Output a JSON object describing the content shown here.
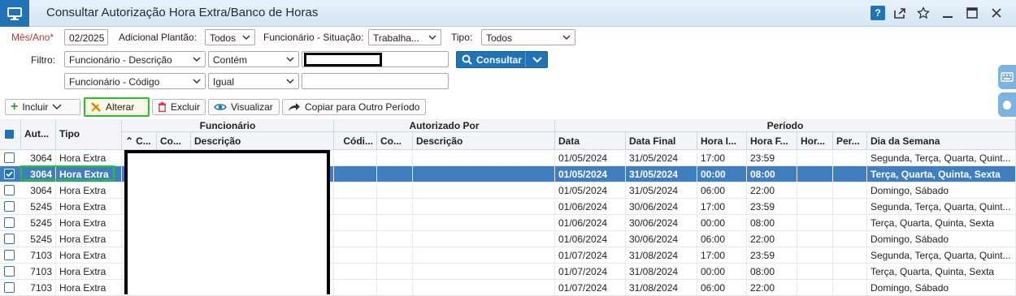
{
  "window": {
    "title": "Consultar Autorização Hora Extra/Banco de Horas",
    "help_label": "?"
  },
  "filters": {
    "mes_ano_label": "Mês/Ano*",
    "mes_ano_value": "02/2025",
    "adicional_label": "Adicional Plantão:",
    "adicional_value": "Todos",
    "func_situacao_label": "Funcionário - Situação:",
    "func_situacao_value": "Trabalha...",
    "tipo_label": "Tipo:",
    "tipo_value": "Todos",
    "filtro_label": "Filtro:",
    "filtro1_field": "Funcionário - Descrição",
    "filtro1_operator": "Contém",
    "filtro1_value": "",
    "filtro2_field": "Funcionário - Código",
    "filtro2_operator": "Igual",
    "filtro2_value": "",
    "consultar_label": "Consultar"
  },
  "toolbar": {
    "incluir": "Incluir",
    "alterar": "Alterar",
    "excluir": "Excluir",
    "visualizar": "Visualizar",
    "copiar": "Copiar para Outro Período"
  },
  "grid": {
    "group_headers": {
      "funcionario": "Funcionário",
      "autorizado_por": "Autorizado Por",
      "periodo": "Período"
    },
    "columns": {
      "aut": "Aut...",
      "tipo": "Tipo",
      "func_c": "C...",
      "func_co": "Co...",
      "func_desc": "Descrição",
      "aut_codi": "Códi...",
      "aut_co": "Co...",
      "aut_desc": "Descrição",
      "data": "Data",
      "data_final": "Data Final",
      "hora_i": "Hora I...",
      "hora_f": "Hora F...",
      "hor": "Hor...",
      "per": "Per...",
      "dia_semana": "Dia da Semana"
    },
    "rows": [
      {
        "aut": "3064",
        "tipo": "Hora Extra",
        "data": "01/05/2024",
        "data_final": "31/05/2024",
        "hora_i": "17:00",
        "hora_f": "23:59",
        "dia": "Segunda, Terça, Quarta, Quint..."
      },
      {
        "aut": "3064",
        "tipo": "Hora Extra",
        "data": "01/05/2024",
        "data_final": "31/05/2024",
        "hora_i": "00:00",
        "hora_f": "08:00",
        "dia": "Terça, Quarta, Quinta, Sexta"
      },
      {
        "aut": "3064",
        "tipo": "Hora Extra",
        "data": "01/05/2024",
        "data_final": "31/05/2024",
        "hora_i": "06:00",
        "hora_f": "22:00",
        "dia": "Domingo, Sábado"
      },
      {
        "aut": "5245",
        "tipo": "Hora Extra",
        "data": "01/06/2024",
        "data_final": "30/06/2024",
        "hora_i": "17:00",
        "hora_f": "23:59",
        "dia": "Segunda, Terça, Quarta, Quint..."
      },
      {
        "aut": "5245",
        "tipo": "Hora Extra",
        "data": "01/06/2024",
        "data_final": "30/06/2024",
        "hora_i": "00:00",
        "hora_f": "08:00",
        "dia": "Terça, Quarta, Quinta, Sexta"
      },
      {
        "aut": "5245",
        "tipo": "Hora Extra",
        "data": "01/06/2024",
        "data_final": "30/06/2024",
        "hora_i": "06:00",
        "hora_f": "22:00",
        "dia": "Domingo, Sábado"
      },
      {
        "aut": "7103",
        "tipo": "Hora Extra",
        "data": "01/07/2024",
        "data_final": "31/08/2024",
        "hora_i": "17:00",
        "hora_f": "23:59",
        "dia": "Segunda, Terça, Quarta, Quint..."
      },
      {
        "aut": "7103",
        "tipo": "Hora Extra",
        "data": "01/07/2024",
        "data_final": "31/08/2024",
        "hora_i": "00:00",
        "hora_f": "08:00",
        "dia": "Terça, Quarta, Quinta, Sexta"
      },
      {
        "aut": "7103",
        "tipo": "Hora Extra",
        "data": "01/07/2024",
        "data_final": "31/08/2024",
        "hora_i": "06:00",
        "hora_f": "22:00",
        "dia": "Domingo, Sábado"
      }
    ],
    "selected_row": 1
  },
  "colors": {
    "accent": "#1f73b8",
    "selected_row": "#3f7fc0",
    "highlight": "#22c32b"
  }
}
